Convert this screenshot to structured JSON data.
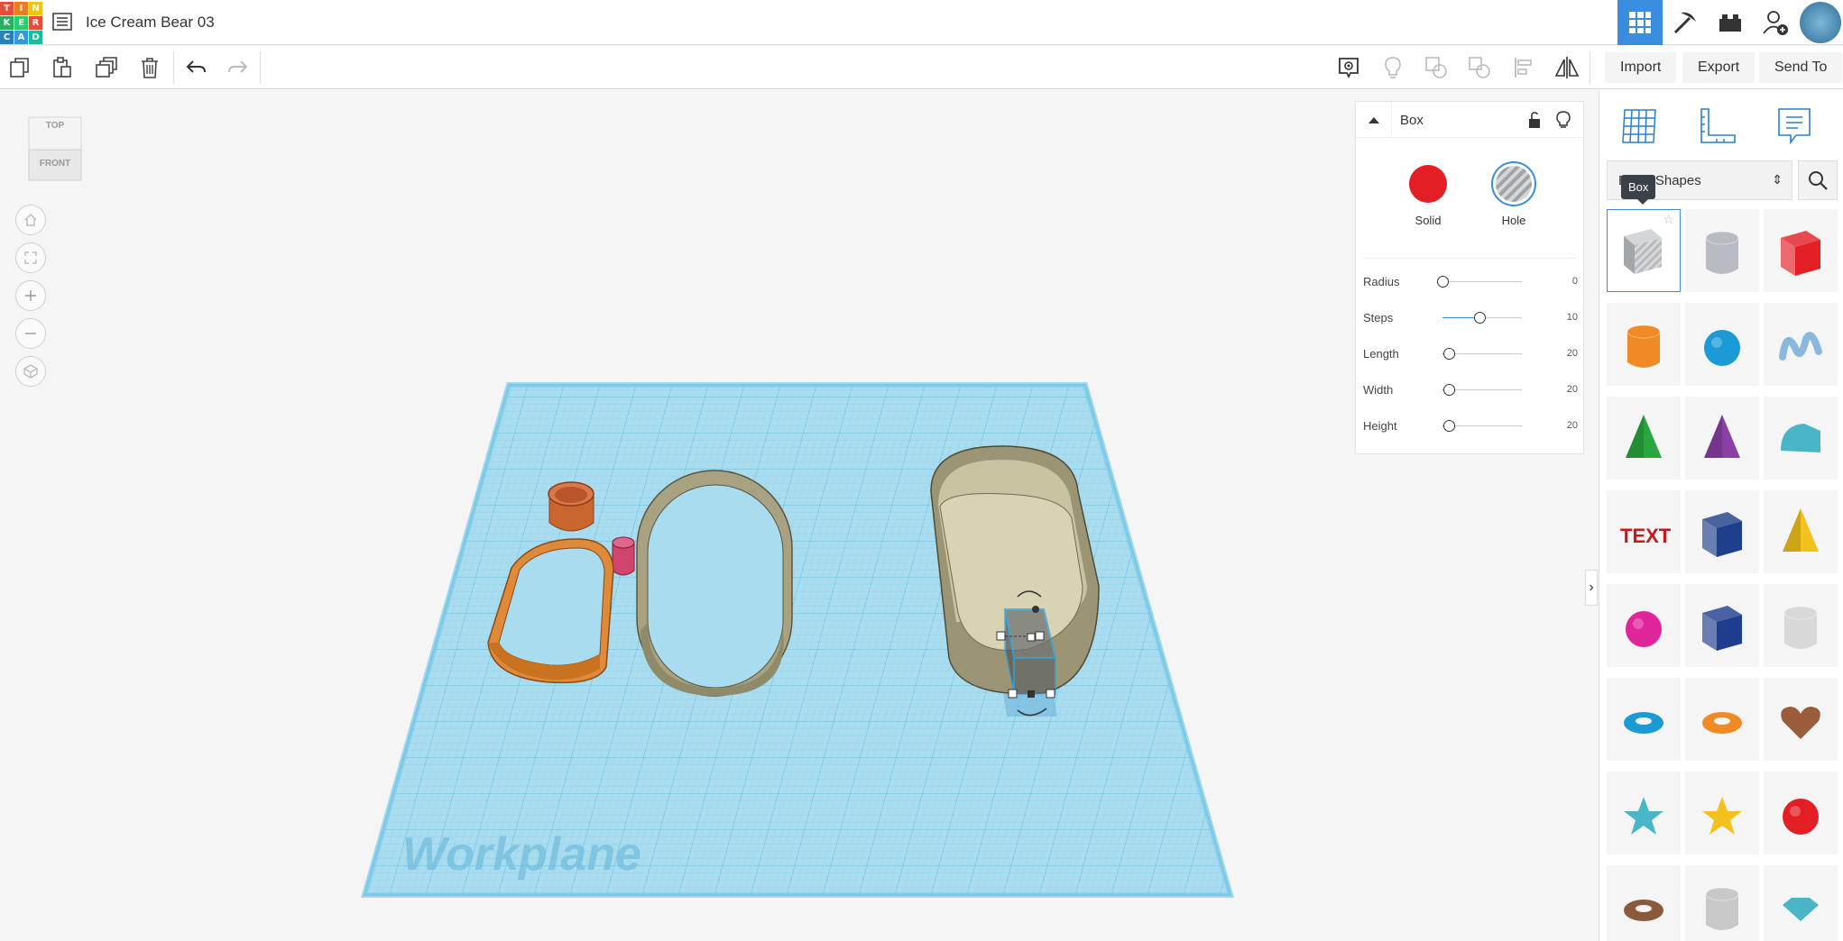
{
  "app": {
    "logo_letters": [
      "T",
      "I",
      "N",
      "K",
      "E",
      "R",
      "C",
      "A",
      "D"
    ],
    "logo_colors": [
      "#e74c3c",
      "#e67e22",
      "#f1c40f",
      "#27ae60",
      "#2ecc71",
      "#e74c3c",
      "#2980b9",
      "#3498db",
      "#1abc9c"
    ],
    "design_title": "Ice Cream Bear 03",
    "accent": "#3a8dde"
  },
  "topbar_right": {
    "icons": [
      "grid-view-icon",
      "pickaxe-icon",
      "bricks-icon",
      "invite-user-icon"
    ],
    "active": "grid-view-icon"
  },
  "toolbar": {
    "left_icons": [
      "copy-icon",
      "paste-icon",
      "duplicate-icon",
      "delete-icon",
      "undo-icon",
      "redo-icon"
    ],
    "right_icons": [
      "notes-icon",
      "light-bulb-icon",
      "group-icon",
      "ungroup-icon",
      "align-icon",
      "mirror-icon"
    ],
    "import_label": "Import",
    "export_label": "Export",
    "send_to_label": "Send To"
  },
  "viewcube": {
    "top_label": "TOP",
    "front_label": "FRONT"
  },
  "nav_controls": [
    "home-view-icon",
    "fit-view-icon",
    "zoom-in-icon",
    "zoom-out-icon",
    "perspective-icon"
  ],
  "workplane": {
    "label": "Workplane",
    "grid_color": "#a9dcef",
    "line_color": "#5fbde0"
  },
  "inspector": {
    "shape_name": "Box",
    "solid_label": "Solid",
    "hole_label": "Hole",
    "solid_color": "#e31e24",
    "params": [
      {
        "label": "Radius",
        "value": "0",
        "fraction": 0.0
      },
      {
        "label": "Steps",
        "value": "10",
        "fraction": 0.47
      },
      {
        "label": "Length",
        "value": "20",
        "fraction": 0.08
      },
      {
        "label": "Width",
        "value": "20",
        "fraction": 0.08
      },
      {
        "label": "Height",
        "value": "20",
        "fraction": 0.08
      }
    ]
  },
  "right_panel": {
    "top_icons": [
      "workplane-grid-icon",
      "ruler-icon",
      "notes-bubble-icon"
    ],
    "category_label": "Basic Shapes",
    "tooltip": "Box",
    "shapes": [
      {
        "name": "box-hole",
        "color": "#b0b6bf"
      },
      {
        "name": "cylinder-hole",
        "color": "#b8bcc2"
      },
      {
        "name": "box",
        "color": "#e31e24"
      },
      {
        "name": "cylinder",
        "color": "#f08a24"
      },
      {
        "name": "sphere",
        "color": "#1c9ad6"
      },
      {
        "name": "scribble",
        "color": "#8ab8dd"
      },
      {
        "name": "roof",
        "color": "#2aa640"
      },
      {
        "name": "cone",
        "color": "#8a3fa6"
      },
      {
        "name": "round-roof",
        "color": "#4ab5c7"
      },
      {
        "name": "text",
        "color": "#c41a1a"
      },
      {
        "name": "wedge",
        "color": "#1e3f8c"
      },
      {
        "name": "pyramid",
        "color": "#f2c11c"
      },
      {
        "name": "half-sphere",
        "color": "#e0249a"
      },
      {
        "name": "polygon",
        "color": "#1f3d8f"
      },
      {
        "name": "paraboloid",
        "color": "#d8d8d8"
      },
      {
        "name": "torus",
        "color": "#1c9ad6"
      },
      {
        "name": "tube",
        "color": "#f08a24"
      },
      {
        "name": "heart",
        "color": "#9a5c3a"
      },
      {
        "name": "star",
        "color": "#4ab5c7"
      },
      {
        "name": "star-yellow",
        "color": "#f2c11c"
      },
      {
        "name": "icosahedron",
        "color": "#e31e24"
      },
      {
        "name": "ring",
        "color": "#8a5a3a"
      },
      {
        "name": "rounded-box",
        "color": "#c8c8c8"
      },
      {
        "name": "gem",
        "color": "#4ab5c7"
      }
    ]
  }
}
